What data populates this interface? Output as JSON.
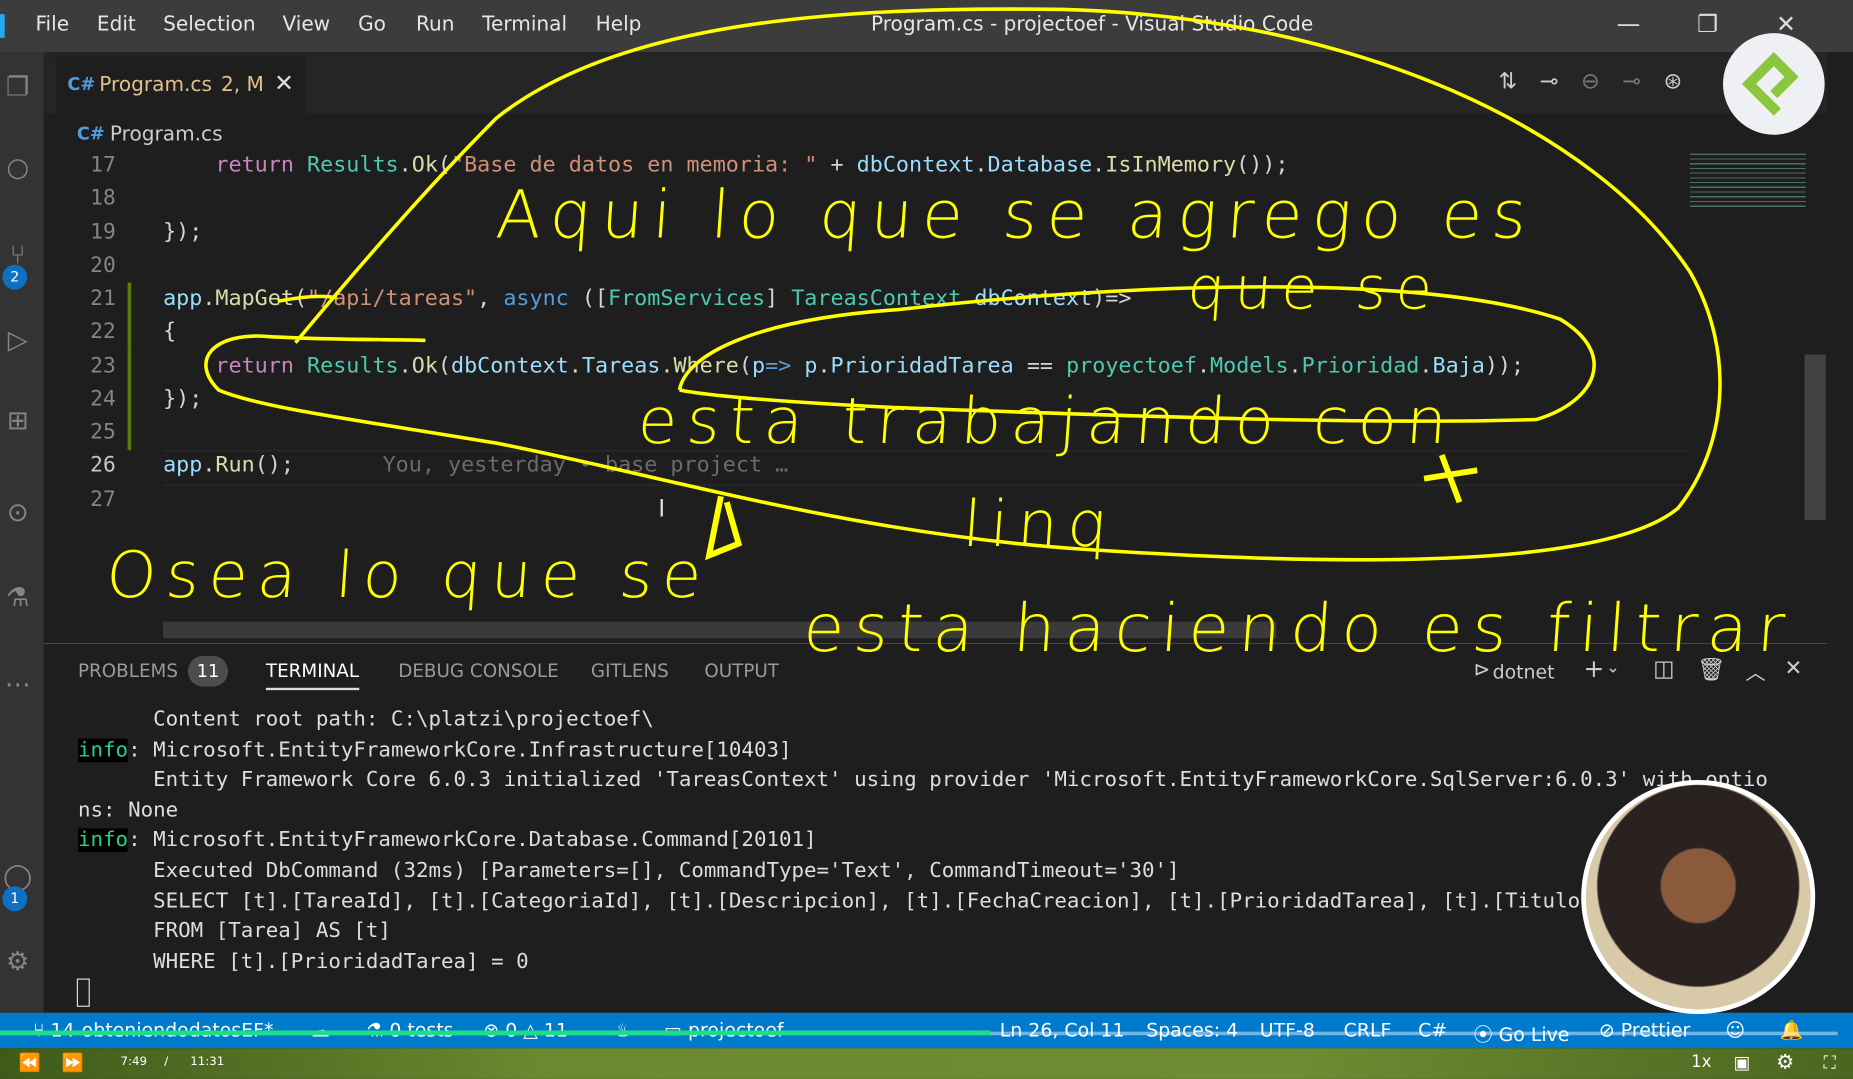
{
  "window": {
    "title": "Program.cs - projectoef - Visual Studio Code",
    "menu": [
      "File",
      "Edit",
      "Selection",
      "View",
      "Go",
      "Run",
      "Terminal",
      "Help"
    ]
  },
  "activity": {
    "source_control_badge": "2",
    "accounts_badge": "1"
  },
  "tab": {
    "label": "Program.cs",
    "status": "2, M"
  },
  "breadcrumb": {
    "file": "Program.cs"
  },
  "editor": {
    "current_line": 26,
    "lines": [
      {
        "n": "17",
        "tokens": [
          [
            "    ",
            "pl"
          ],
          [
            "return",
            "kw"
          ],
          [
            " ",
            "pl"
          ],
          [
            "Results",
            "ty"
          ],
          [
            ".",
            "pl"
          ],
          [
            "Ok",
            "fn"
          ],
          [
            "(",
            "pl"
          ],
          [
            "\"Base de datos en memoria: \"",
            "st"
          ],
          [
            " + ",
            "pl"
          ],
          [
            "dbContext",
            "va"
          ],
          [
            ".",
            "pl"
          ],
          [
            "Database",
            "va"
          ],
          [
            ".",
            "pl"
          ],
          [
            "IsInMemory",
            "fn"
          ],
          [
            "());",
            "pl"
          ]
        ]
      },
      {
        "n": "18",
        "tokens": []
      },
      {
        "n": "19",
        "tokens": [
          [
            "});",
            "pl"
          ]
        ]
      },
      {
        "n": "20",
        "tokens": []
      },
      {
        "n": "21",
        "tokens": [
          [
            "app",
            "va"
          ],
          [
            ".",
            "pl"
          ],
          [
            "MapGet",
            "fn"
          ],
          [
            "(",
            "pl"
          ],
          [
            "\"/api/tareas\"",
            "st"
          ],
          [
            ", ",
            "pl"
          ],
          [
            "async",
            "bl"
          ],
          [
            " ([",
            "pl"
          ],
          [
            "FromServices",
            "ty"
          ],
          [
            "] ",
            "pl"
          ],
          [
            "TareasContext",
            "ty"
          ],
          [
            " ",
            "pl"
          ],
          [
            "dbContext",
            "va"
          ],
          [
            ")=>",
            "pl"
          ]
        ]
      },
      {
        "n": "22",
        "tokens": [
          [
            "{",
            "pl"
          ]
        ]
      },
      {
        "n": "23",
        "tokens": [
          [
            "    ",
            "pl"
          ],
          [
            "return",
            "kw"
          ],
          [
            " ",
            "pl"
          ],
          [
            "Results",
            "ty"
          ],
          [
            ".",
            "pl"
          ],
          [
            "Ok",
            "fn"
          ],
          [
            "(",
            "pl"
          ],
          [
            "dbContext",
            "va"
          ],
          [
            ".",
            "pl"
          ],
          [
            "Tareas",
            "va"
          ],
          [
            ".",
            "pl"
          ],
          [
            "Where",
            "fn"
          ],
          [
            "(",
            "pl"
          ],
          [
            "p",
            "va"
          ],
          [
            "=> ",
            "bl"
          ],
          [
            "p",
            "va"
          ],
          [
            ".",
            "pl"
          ],
          [
            "PrioridadTarea",
            "va"
          ],
          [
            " == ",
            "pl"
          ],
          [
            "proyectoef",
            "ty"
          ],
          [
            ".",
            "pl"
          ],
          [
            "Models",
            "ty"
          ],
          [
            ".",
            "pl"
          ],
          [
            "Prioridad",
            "ty"
          ],
          [
            ".",
            "pl"
          ],
          [
            "Baja",
            "va"
          ],
          [
            "));",
            "pl"
          ]
        ]
      },
      {
        "n": "24",
        "tokens": [
          [
            "});",
            "pl"
          ]
        ]
      },
      {
        "n": "25",
        "tokens": []
      },
      {
        "n": "26",
        "tokens": [
          [
            "app",
            "va"
          ],
          [
            ".",
            "pl"
          ],
          [
            "Run",
            "fn"
          ],
          [
            "();",
            "pl"
          ]
        ]
      },
      {
        "n": "27",
        "tokens": []
      }
    ],
    "blame": "You, yesterday • base project …"
  },
  "panel": {
    "tabs": [
      "PROBLEMS",
      "TERMINAL",
      "DEBUG CONSOLE",
      "GITLENS",
      "OUTPUT"
    ],
    "active_tab": "TERMINAL",
    "problems_count": "11",
    "terminal_name": "dotnet",
    "terminal_lines": [
      {
        "prefix": "",
        "text": "      Content root path: C:\\platzi\\projectoef\\"
      },
      {
        "prefix": "info",
        "text": ": Microsoft.EntityFrameworkCore.Infrastructure[10403]"
      },
      {
        "prefix": "",
        "text": "      Entity Framework Core 6.0.3 initialized 'TareasContext' using provider 'Microsoft.EntityFrameworkCore.SqlServer:6.0.3' with optio"
      },
      {
        "prefix": "",
        "text": "ns: None"
      },
      {
        "prefix": "info",
        "text": ": Microsoft.EntityFrameworkCore.Database.Command[20101]"
      },
      {
        "prefix": "",
        "text": "      Executed DbCommand (32ms) [Parameters=[], CommandType='Text', CommandTimeout='30']"
      },
      {
        "prefix": "",
        "text": "      SELECT [t].[TareaId], [t].[CategoriaId], [t].[Descripcion], [t].[FechaCreacion], [t].[PrioridadTarea], [t].[Titulo]"
      },
      {
        "prefix": "",
        "text": "      FROM [Tarea] AS [t]"
      },
      {
        "prefix": "",
        "text": "      WHERE [t].[PrioridadTarea] = 0"
      }
    ]
  },
  "status": {
    "branch": "14-obteniendodatosEF*",
    "tests": "0 tests",
    "errors": "0",
    "warnings": "11",
    "folder": "projectoef",
    "position": "Ln 26, Col 11",
    "spaces": "Spaces: 4",
    "encoding": "UTF-8",
    "eol": "CRLF",
    "language": "C#",
    "golive": "Go Live",
    "prettier": "Prettier"
  },
  "player": {
    "current": "7:49",
    "separator": "/",
    "duration": "11:31",
    "progress": 0.679,
    "speed": "1x"
  },
  "annotations": {
    "a1": "Aqui lo que se agrego es",
    "a2": "que se",
    "a3": "esta trabajando con",
    "a4": "linq",
    "b1": "Osea lo que se",
    "b2": "esta haciendo es filtrar",
    "color": "#ffff00"
  },
  "colors": {
    "statusbar": "#007acc",
    "accent_logo": "#8cc63f"
  }
}
